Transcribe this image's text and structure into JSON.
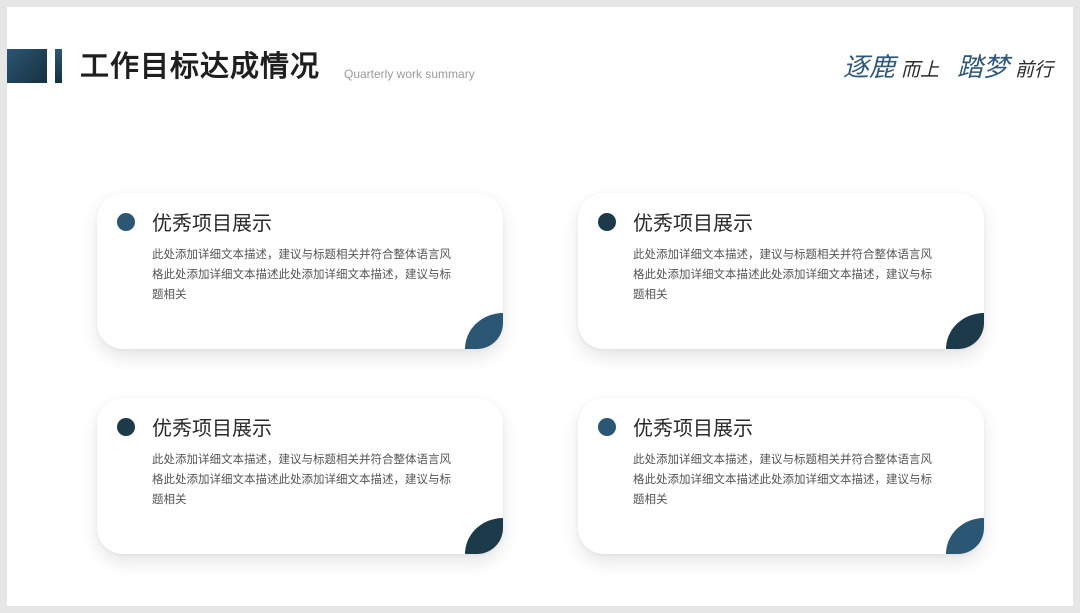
{
  "header": {
    "title": "工作目标达成情况",
    "subtitle": "Quarterly work summary",
    "slogan": {
      "part1_big": "逐鹿",
      "part1_small": "而上",
      "part2_big": "踏梦",
      "part2_small": "前行"
    }
  },
  "cards": [
    {
      "title": "优秀项目展示",
      "body": "此处添加详细文本描述，建议与标题相关并符合整体语言风格此处添加详细文本描述此处添加详细文本描述，建议与标题相关",
      "dot_color": "#2b5674",
      "corner_color": "#2b5674"
    },
    {
      "title": "优秀项目展示",
      "body": "此处添加详细文本描述，建议与标题相关并符合整体语言风格此处添加详细文本描述此处添加详细文本描述，建议与标题相关",
      "dot_color": "#1d3a4b",
      "corner_color": "#1d3a4b"
    },
    {
      "title": "优秀项目展示",
      "body": "此处添加详细文本描述，建议与标题相关并符合整体语言风格此处添加详细文本描述此处添加详细文本描述，建议与标题相关",
      "dot_color": "#1d3a4b",
      "corner_color": "#1d3a4b"
    },
    {
      "title": "优秀项目展示",
      "body": "此处添加详细文本描述，建议与标题相关并符合整体语言风格此处添加详细文本描述此处添加详细文本描述，建议与标题相关",
      "dot_color": "#2b5674",
      "corner_color": "#2b5674"
    }
  ]
}
